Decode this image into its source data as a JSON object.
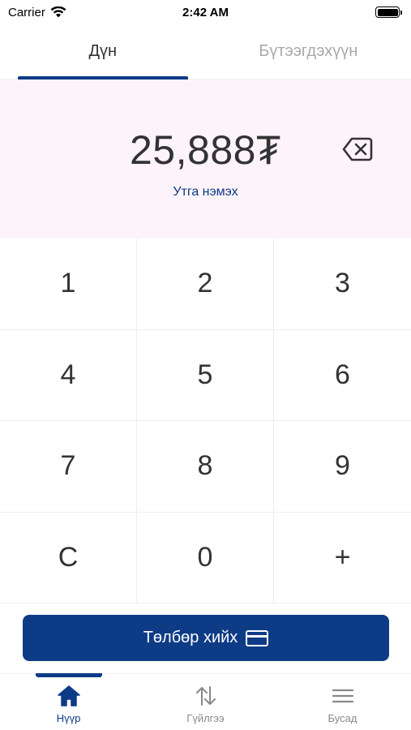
{
  "status_bar": {
    "carrier": "Carrier",
    "time": "2:42 AM"
  },
  "tabs": [
    {
      "label": "Дүн",
      "active": true
    },
    {
      "label": "Бүтээгдэхүүн",
      "active": false
    }
  ],
  "amount": {
    "value": "25,888₮",
    "add_value_label": "Утга нэмэх"
  },
  "keypad": {
    "keys": [
      "1",
      "2",
      "3",
      "4",
      "5",
      "6",
      "7",
      "8",
      "9",
      "C",
      "0",
      "+"
    ]
  },
  "pay_button": {
    "label": "Төлбөр хийх"
  },
  "bottom_nav": [
    {
      "label": "Нүүр",
      "icon": "home-icon",
      "active": true
    },
    {
      "label": "Гүйлгээ",
      "icon": "transfer-arrows-icon",
      "active": false
    },
    {
      "label": "Бусад",
      "icon": "menu-icon",
      "active": false
    }
  ],
  "colors": {
    "accent": "#0d3b86",
    "amount_background": "#fdf3fa",
    "inactive_text": "#a9a9a9"
  }
}
